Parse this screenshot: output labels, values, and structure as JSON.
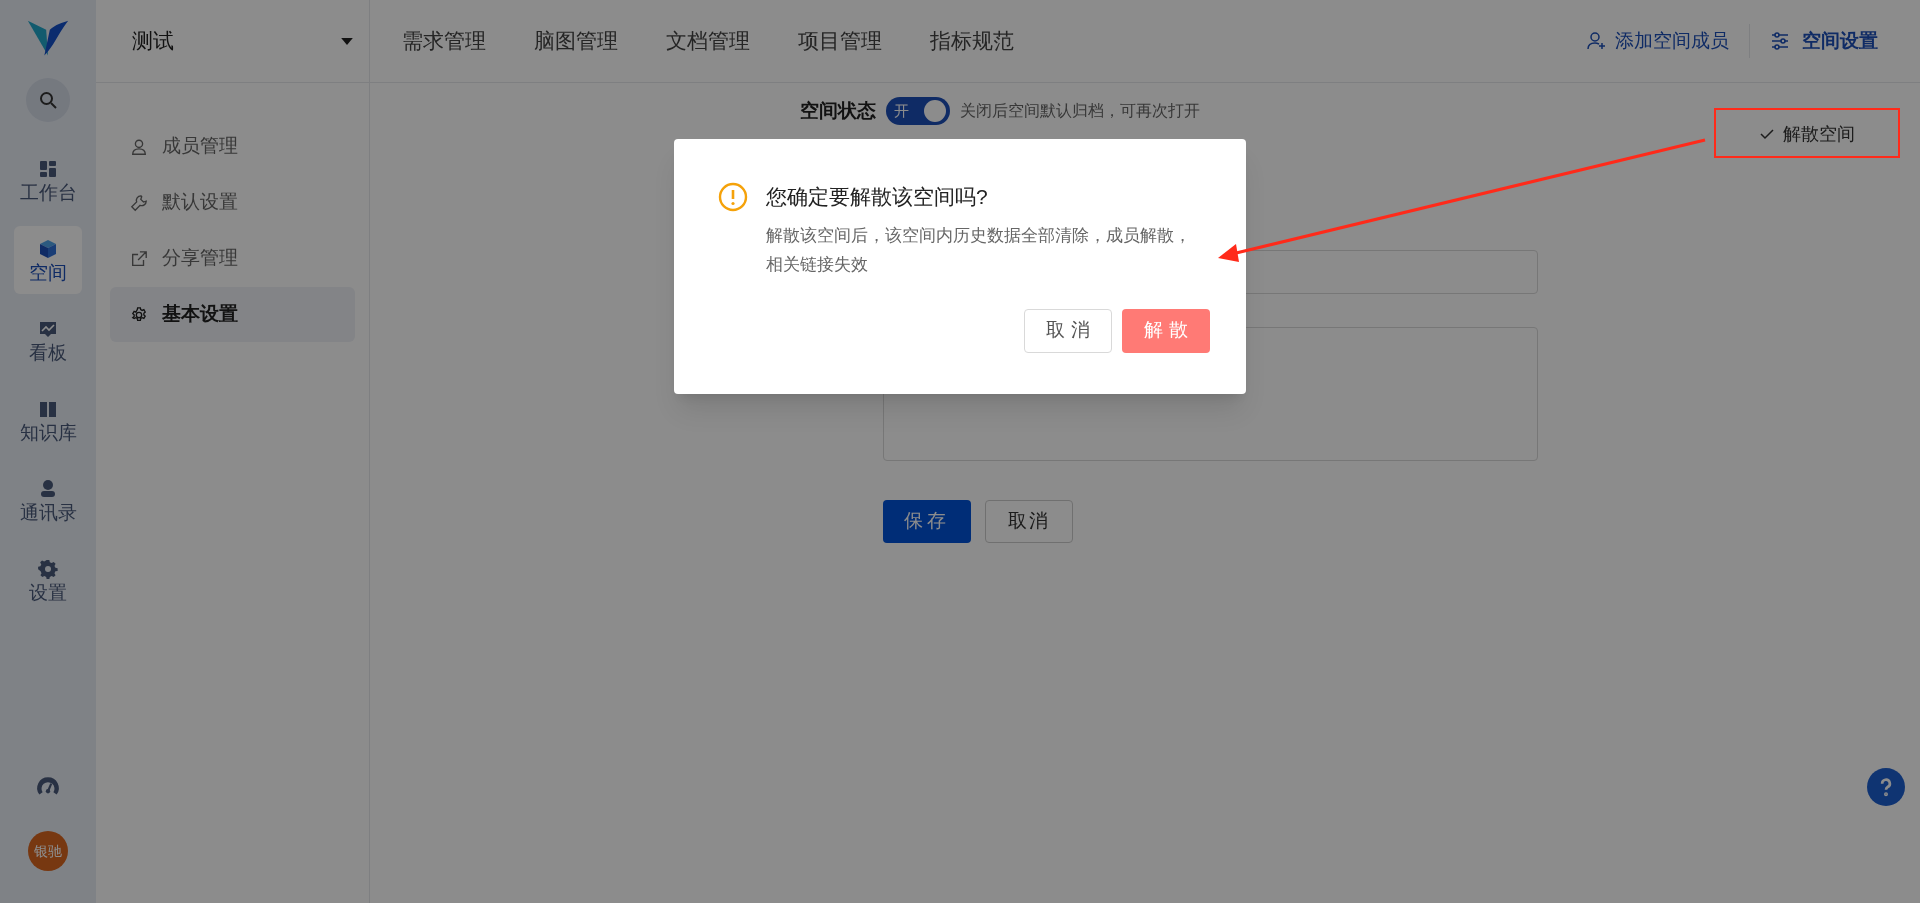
{
  "rail": {
    "items": [
      {
        "label": "工作台",
        "selected": false
      },
      {
        "label": "空间",
        "selected": true
      },
      {
        "label": "看板",
        "selected": false
      },
      {
        "label": "知识库",
        "selected": false
      },
      {
        "label": "通讯录",
        "selected": false
      },
      {
        "label": "设置",
        "selected": false
      }
    ],
    "avatar": "银驰"
  },
  "space": {
    "name": "测试"
  },
  "top_nav": {
    "tabs": [
      {
        "label": "需求管理",
        "selected": false
      },
      {
        "label": "脑图管理",
        "selected": false
      },
      {
        "label": "文档管理",
        "selected": false
      },
      {
        "label": "项目管理",
        "selected": false
      },
      {
        "label": "指标规范",
        "selected": false
      }
    ],
    "add_member": "添加空间成员",
    "space_settings": "空间设置"
  },
  "settings_menu": [
    {
      "label": "成员管理",
      "selected": false
    },
    {
      "label": "默认设置",
      "selected": false
    },
    {
      "label": "分享管理",
      "selected": false
    },
    {
      "label": "基本设置",
      "selected": true
    }
  ],
  "form": {
    "status_label": "空间状态",
    "status_toggle": {
      "on": true,
      "label": "开"
    },
    "status_hint": "关闭后空间默认归档，可再次打开",
    "save": "保存",
    "cancel": "取消",
    "dissolve": "解散空间"
  },
  "dialog": {
    "title": "您确定要解散该空间吗?",
    "message": "解散该空间后，该空间内历史数据全部清除，成员解散，相关链接失效",
    "cancel": "取 消",
    "confirm": "解 散"
  }
}
